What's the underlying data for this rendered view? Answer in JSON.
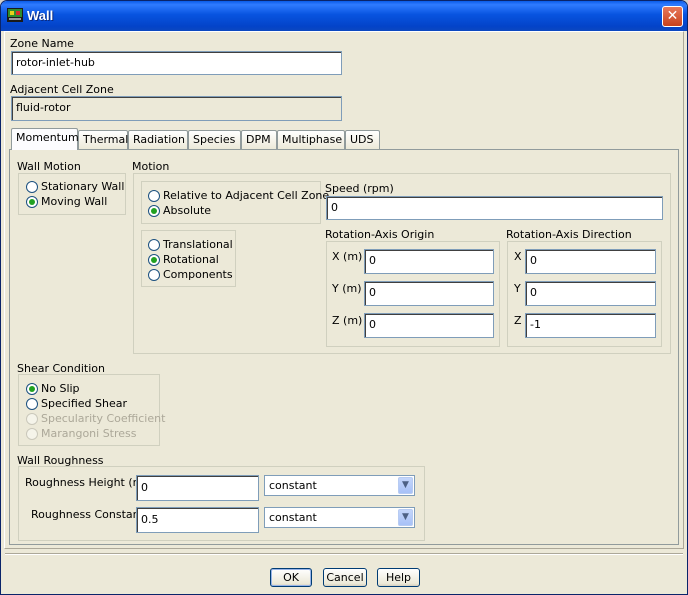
{
  "window": {
    "title": "Wall",
    "close_label": "✕"
  },
  "zone": {
    "name_label": "Zone Name",
    "name_value": "rotor-inlet-hub",
    "adjacent_label": "Adjacent Cell Zone",
    "adjacent_value": "fluid-rotor"
  },
  "tabs": [
    "Momentum",
    "Thermal",
    "Radiation",
    "Species",
    "DPM",
    "Multiphase",
    "UDS"
  ],
  "active_tab": "Momentum",
  "wall_motion": {
    "label": "Wall Motion",
    "options": [
      "Stationary Wall",
      "Moving Wall"
    ],
    "selected": "Moving Wall"
  },
  "motion": {
    "label": "Motion",
    "reference": {
      "options": [
        "Relative to Adjacent Cell Zone",
        "Absolute"
      ],
      "selected": "Absolute"
    },
    "type": {
      "options": [
        "Translational",
        "Rotational",
        "Components"
      ],
      "selected": "Rotational"
    },
    "speed_label": "Speed (rpm)",
    "speed_value": "0",
    "origin": {
      "label": "Rotation-Axis Origin",
      "x_label": "X (m)",
      "x_value": "0",
      "y_label": "Y (m)",
      "y_value": "0",
      "z_label": "Z (m)",
      "z_value": "0"
    },
    "direction": {
      "label": "Rotation-Axis Direction",
      "x_label": "X",
      "x_value": "0",
      "y_label": "Y",
      "y_value": "0",
      "z_label": "Z",
      "z_value": "-1"
    }
  },
  "shear": {
    "label": "Shear Condition",
    "options": [
      "No Slip",
      "Specified Shear",
      "Specularity Coefficient",
      "Marangoni Stress"
    ],
    "selected": "No Slip",
    "disabled": [
      "Specularity Coefficient",
      "Marangoni Stress"
    ]
  },
  "roughness": {
    "label": "Wall Roughness",
    "height_label": "Roughness Height (m)",
    "height_value": "0",
    "height_method": "constant",
    "constant_label": "Roughness Constant",
    "constant_value": "0.5",
    "constant_method": "constant"
  },
  "buttons": {
    "ok": "OK",
    "cancel": "Cancel",
    "help": "Help"
  },
  "colors": {
    "titlebar": "#0854e0",
    "dialog_bg": "#ece9d8",
    "radio_dot": "#21a121"
  }
}
